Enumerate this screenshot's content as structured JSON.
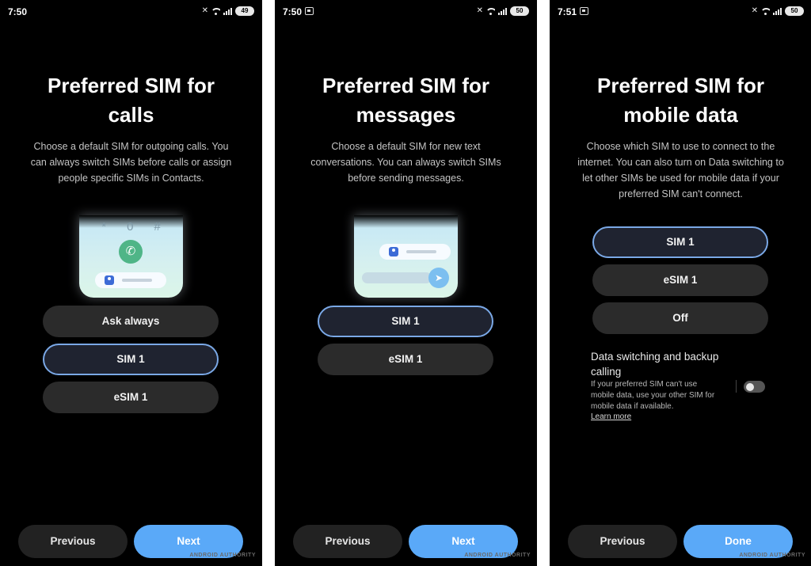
{
  "screens": [
    {
      "status": {
        "time": "7:50",
        "battery": "49"
      },
      "title_line1": "Preferred SIM for",
      "title_line2": "calls",
      "desc_lines": [
        "Choose a default SIM for outgoing calls. You",
        "can always switch SIMs before calls or assign",
        "people specific SIMs in Contacts."
      ],
      "illustration": {
        "dialpad_keys": [
          "*",
          "0",
          "#"
        ]
      },
      "options": [
        "Ask always",
        "SIM 1",
        "eSIM 1"
      ],
      "selected_option": "SIM 1",
      "prev_label": "Previous",
      "next_label": "Next",
      "watermark": "ANDROID AUTHORITY"
    },
    {
      "status": {
        "time": "7:50",
        "battery": "50"
      },
      "title_line1": "Preferred SIM for",
      "title_line2": "messages",
      "desc_lines": [
        "Choose a default SIM for new text",
        "conversations. You can always switch SIMs",
        "before sending messages."
      ],
      "options": [
        "SIM 1",
        "eSIM 1"
      ],
      "selected_option": "SIM 1",
      "prev_label": "Previous",
      "next_label": "Next",
      "watermark": "ANDROID AUTHORITY"
    },
    {
      "status": {
        "time": "7:51",
        "battery": "50"
      },
      "title_line1": "Preferred SIM for",
      "title_line2": "mobile data",
      "desc_lines": [
        "Choose which SIM to use to connect to the",
        "internet. You can also turn on Data switching to",
        "let other SIMs be used for mobile data if your",
        "preferred SIM can't connect."
      ],
      "options": [
        "SIM 1",
        "eSIM 1",
        "Off"
      ],
      "selected_option": "SIM 1",
      "data_switching": {
        "title_line1": "Data switching and backup",
        "title_line2": "calling",
        "desc_lines": [
          "If your preferred SIM can't use",
          "mobile data, use your other SIM for",
          "mobile data if available."
        ],
        "learn_more": "Learn more",
        "enabled": false
      },
      "prev_label": "Previous",
      "done_label": "Done",
      "watermark": "ANDROID AUTHORITY"
    }
  ],
  "colors": {
    "background": "#000000",
    "option_bg": "#2b2b2b",
    "selected_border": "#7aa8e6",
    "primary_button": "#5aa9f8",
    "secondary_button": "#222222"
  }
}
